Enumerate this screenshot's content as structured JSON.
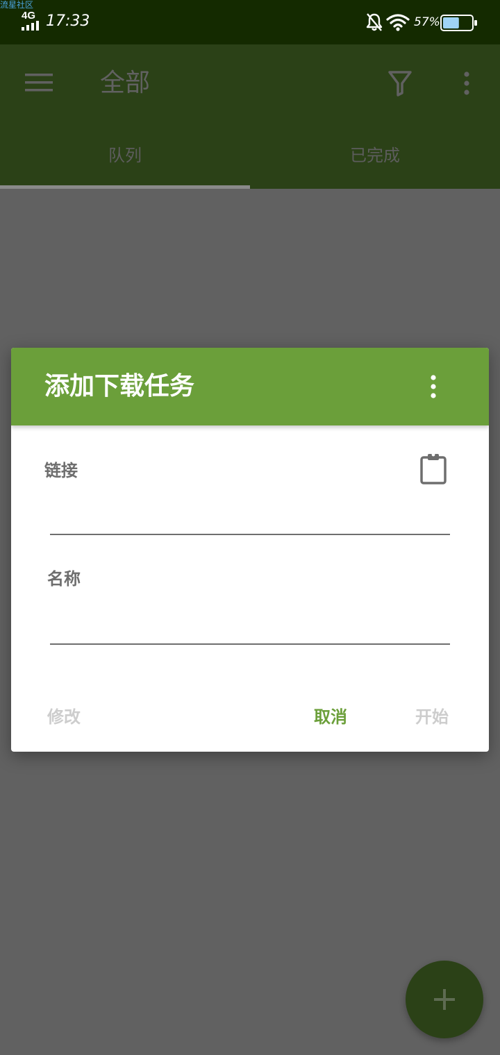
{
  "status_bar": {
    "watermark": "流星社区",
    "network": "4G",
    "time": "17:33",
    "battery_percent": "57%",
    "battery_level": 0.57,
    "icons": [
      "signal-icon",
      "bell-off-icon",
      "wifi-icon",
      "battery-icon"
    ]
  },
  "app_bar": {
    "title": "全部",
    "icons": [
      "menu-icon",
      "filter-icon",
      "more-vert-icon"
    ],
    "tabs": [
      {
        "label": "队列",
        "selected": true
      },
      {
        "label": "已完成",
        "selected": false
      }
    ]
  },
  "dialog": {
    "title": "添加下载任务",
    "menu_icon": "more-vert-icon",
    "link_label": "链接",
    "link_value": "",
    "clipboard_icon": "clipboard-icon",
    "name_label": "名称",
    "name_value": "",
    "buttons": {
      "modify": "修改",
      "cancel": "取消",
      "start": "开始"
    }
  },
  "fab": {
    "icon": "plus-icon"
  },
  "colors": {
    "status_bar_bg": "#142a00",
    "app_bar_dimmed": "#2b4117",
    "dialog_header": "#6b9f3a",
    "accent": "#6b9f3a",
    "scrim_bg": "#616161",
    "disabled_text": "#cdcdcd"
  }
}
